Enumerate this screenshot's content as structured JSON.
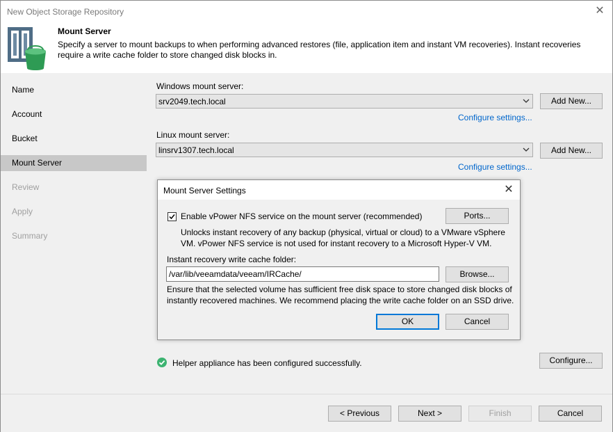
{
  "window": {
    "title": "New Object Storage Repository",
    "close_glyph": "✕"
  },
  "header": {
    "title": "Mount Server",
    "description": "Specify a server to mount backups to when performing advanced restores (file, application item and instant VM recoveries). Instant recoveries require a write cache folder to store changed disk blocks in.",
    "icon": "object-storage-bucket-icon"
  },
  "sidebar": {
    "items": [
      {
        "label": "Name",
        "state": "normal"
      },
      {
        "label": "Account",
        "state": "normal"
      },
      {
        "label": "Bucket",
        "state": "normal"
      },
      {
        "label": "Mount Server",
        "state": "active"
      },
      {
        "label": "Review",
        "state": "disabled"
      },
      {
        "label": "Apply",
        "state": "disabled"
      },
      {
        "label": "Summary",
        "state": "disabled"
      }
    ]
  },
  "main": {
    "windows_label": "Windows mount server:",
    "windows_value": "srv2049.tech.local",
    "windows_add": "Add New...",
    "windows_configure": "Configure settings...",
    "linux_label": "Linux mount server:",
    "linux_value": "linsrv1307.tech.local",
    "linux_add": "Add New...",
    "linux_configure": "Configure settings...",
    "status_text": "Helper appliance has been configured successfully.",
    "status_color": "#3cb371",
    "configure_button": "Configure..."
  },
  "dialog": {
    "title": "Mount Server Settings",
    "close_glyph": "✕",
    "checkbox_label": "Enable vPower NFS service on the mount server (recommended)",
    "checkbox_checked": true,
    "ports_button": "Ports...",
    "info_line1": "Unlocks instant recovery of any backup (physical, virtual or cloud) to a VMware vSphere",
    "info_line2": "VM.  vPower NFS service is not used for instant recovery to a Microsoft Hyper-V VM.",
    "cache_label": "Instant recovery write cache folder:",
    "cache_value": "/var/lib/veeamdata/veeam/IRCache/",
    "browse_button": "Browse...",
    "note_line1": "Ensure that the selected volume has sufficient free disk space to store changed disk blocks of",
    "note_line2": "instantly recovered machines. We recommend placing the write cache folder on an SSD drive.",
    "ok_button": "OK",
    "cancel_button": "Cancel"
  },
  "footer": {
    "previous": "< Previous",
    "next": "Next >",
    "finish": "Finish",
    "cancel": "Cancel"
  }
}
